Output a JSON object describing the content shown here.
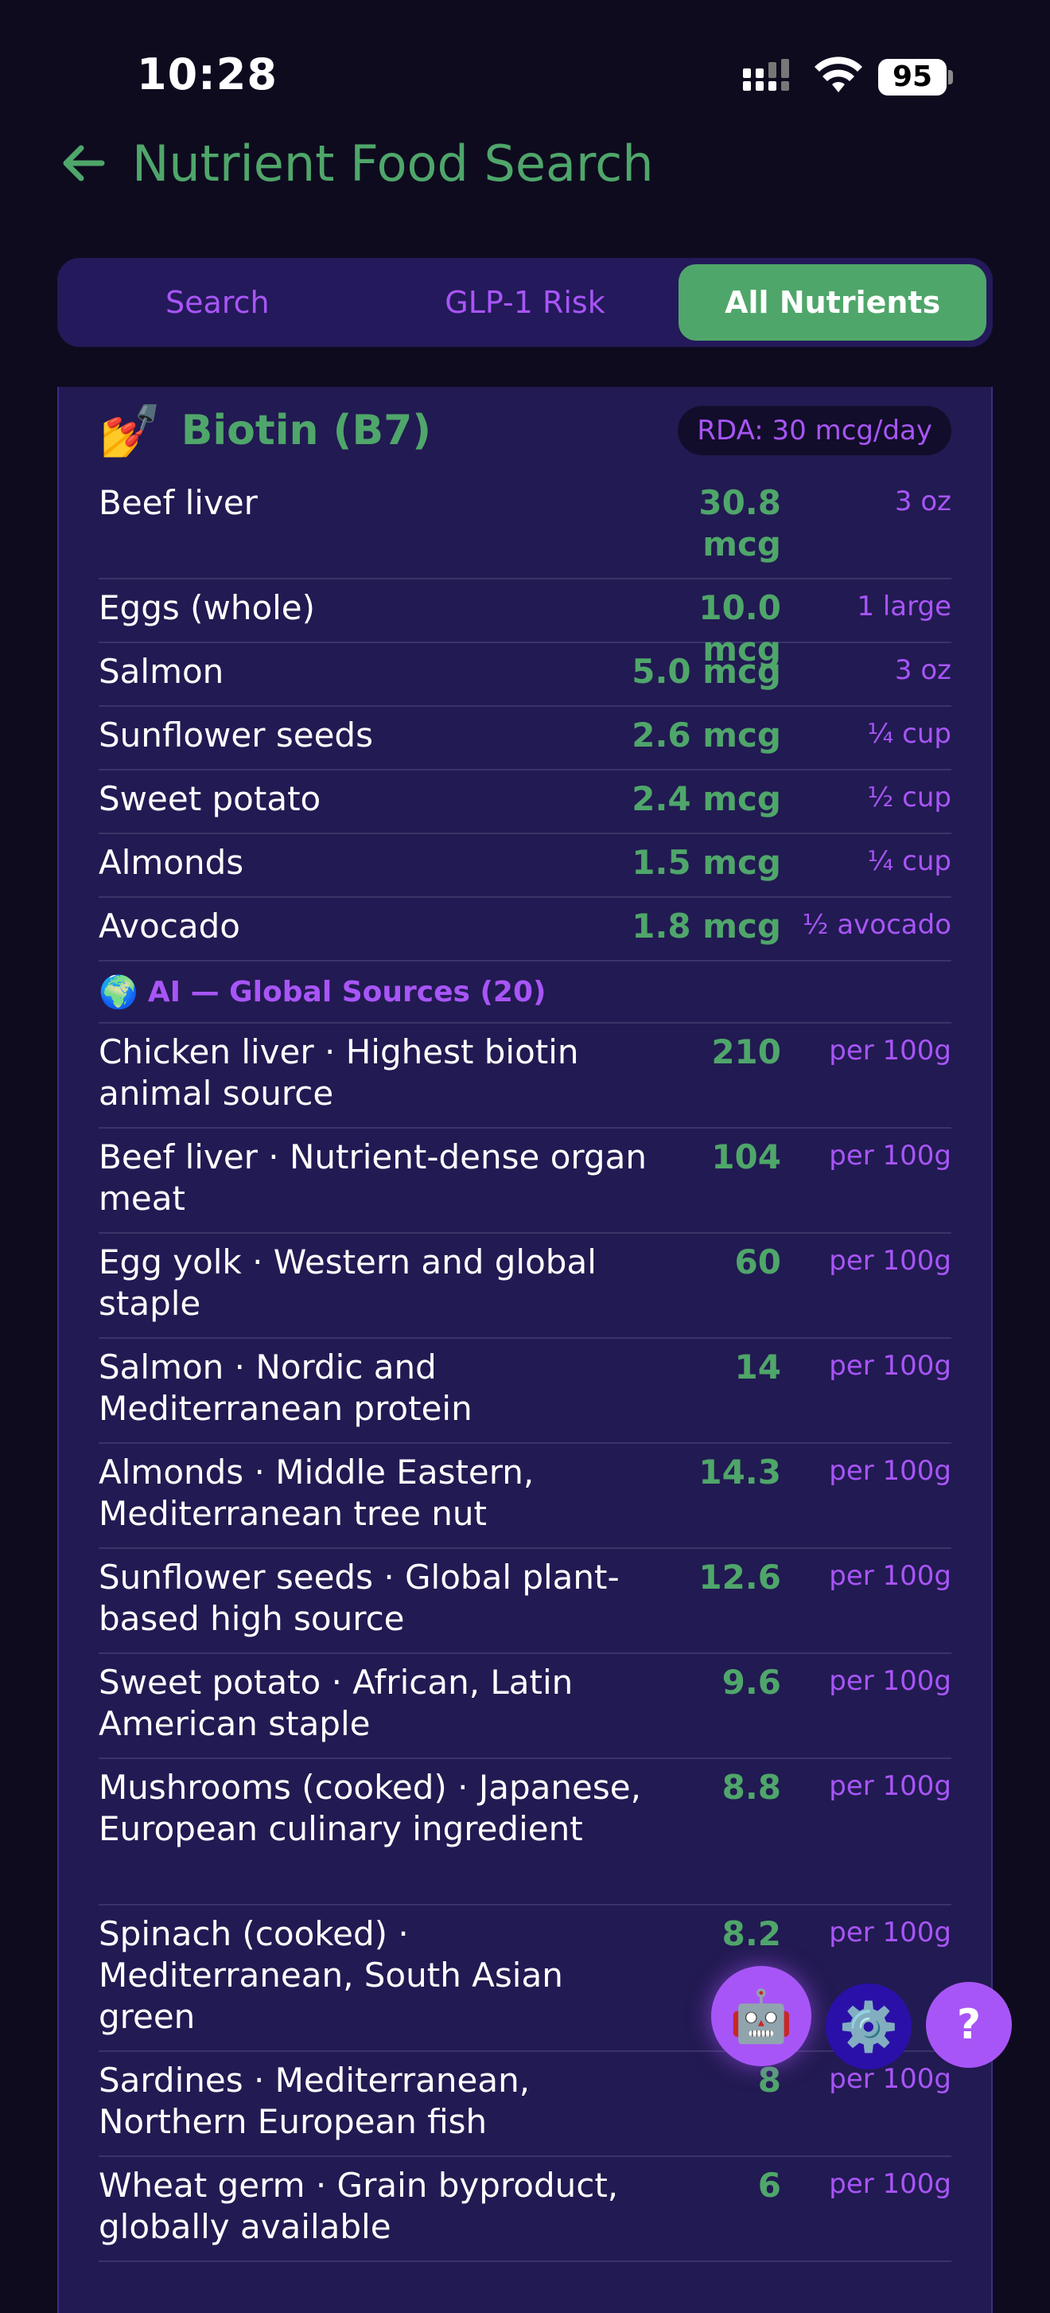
{
  "status": {
    "time": "10:28",
    "battery": "95"
  },
  "header": {
    "title": "Nutrient Food Search"
  },
  "tabs": [
    {
      "label": "Search",
      "active": false
    },
    {
      "label": "GLP-1 Risk",
      "active": false
    },
    {
      "label": "All Nutrients",
      "active": true
    }
  ],
  "nutrient": {
    "icon": "💅",
    "name": "Biotin (B7)",
    "rda": "RDA: 30 mcg/day",
    "foods": [
      {
        "name": "Beef liver",
        "amount": "30.8 mcg",
        "serving": "3 oz"
      },
      {
        "name": "Eggs (whole)",
        "amount": "10.0 mcg",
        "serving": "1 large"
      },
      {
        "name": "Salmon",
        "amount": "5.0 mcg",
        "serving": "3 oz"
      },
      {
        "name": "Sunflower seeds",
        "amount": "2.6 mcg",
        "serving": "¼ cup"
      },
      {
        "name": "Sweet potato",
        "amount": "2.4 mcg",
        "serving": "½ cup"
      },
      {
        "name": "Almonds",
        "amount": "1.5 mcg",
        "serving": "¼ cup"
      },
      {
        "name": "Avocado",
        "amount": "1.8 mcg",
        "serving": "½ avocado"
      }
    ],
    "global_label": "AI — Global Sources (20)",
    "global_icon": "🌍",
    "global": [
      {
        "name": "Chicken liver · Highest biotin animal source",
        "amount": "210",
        "serving": "per 100g"
      },
      {
        "name": "Beef liver · Nutrient-dense organ meat",
        "amount": "104",
        "serving": "per 100g"
      },
      {
        "name": "Egg yolk · Western and global staple",
        "amount": "60",
        "serving": "per 100g"
      },
      {
        "name": "Salmon · Nordic and Mediterranean protein",
        "amount": "14",
        "serving": "per 100g"
      },
      {
        "name": "Almonds · Middle Eastern, Mediterranean tree nut",
        "amount": "14.3",
        "serving": "per 100g"
      },
      {
        "name": "Sunflower seeds · Global plant-based high source",
        "amount": "12.6",
        "serving": "per 100g"
      },
      {
        "name": "Sweet potato · African, Latin American staple",
        "amount": "9.6",
        "serving": "per 100g"
      },
      {
        "name": "Mushrooms (cooked) · Japanese, European culinary ingredient",
        "amount": "8.8",
        "serving": "per 100g"
      },
      {
        "name": "Spinach (cooked) · Mediterranean, South Asian green",
        "amount": "8.2",
        "serving": "per 100g"
      },
      {
        "name": "Sardines · Mediterranean, Northern European fish",
        "amount": "8",
        "serving": "per 100g"
      },
      {
        "name": "Wheat germ · Grain byproduct, globally available",
        "amount": "6",
        "serving": "per 100g"
      }
    ]
  },
  "fabs": {
    "robot_icon": "🤖",
    "gear_icon": "⚙️",
    "help_label": "?"
  }
}
